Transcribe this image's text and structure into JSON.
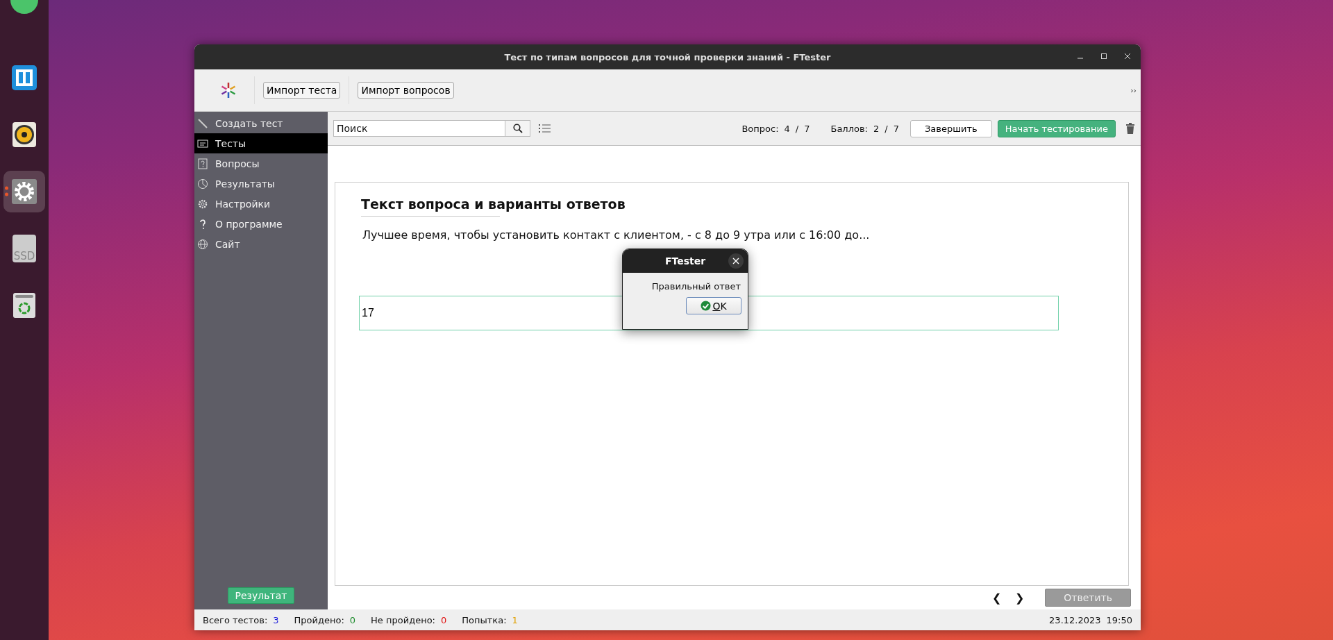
{
  "dock": [
    {
      "kind": "green",
      "running": false
    },
    {
      "kind": "split",
      "running": false
    },
    {
      "kind": "speaker",
      "running": false
    },
    {
      "kind": "gear",
      "running": true
    },
    {
      "kind": "ssd",
      "label": "SSD",
      "running": false
    },
    {
      "kind": "trash",
      "running": false
    }
  ],
  "window": {
    "title": "Тест по типам вопросов для точной проверки знаний - FTester"
  },
  "toolbar": {
    "buttons": [
      "Импорт теста",
      "Импорт вопросов"
    ],
    "overflow": "››"
  },
  "sidebar": {
    "items": [
      {
        "label": "Создать тест",
        "selected": false
      },
      {
        "label": "Тесты",
        "selected": true
      },
      {
        "label": "Вопросы",
        "selected": false
      },
      {
        "label": "Результаты",
        "selected": false
      },
      {
        "label": "Настройки",
        "selected": false
      },
      {
        "label": "О программе",
        "selected": false
      },
      {
        "label": "Сайт",
        "selected": false
      }
    ],
    "result_button": "Результат"
  },
  "top_bar": {
    "search": {
      "placeholder": "Поиск"
    },
    "question_label": "Вопрос:",
    "question_current": "4",
    "question_sep": "/",
    "question_total": "7",
    "score_label": "Баллов:",
    "score_current": "2",
    "score_sep": "/",
    "score_total": "7",
    "finish_button": "Завершить",
    "start_button": "Начать тестирование"
  },
  "question": {
    "heading": "Текст вопроса и варианты ответов",
    "text": "Лучшее время, чтобы установить контакт с клиентом, - с 8 до 9 утра или с 16:00 до...",
    "answer": "17"
  },
  "nav": {
    "prev": "❮",
    "next": "❯",
    "answer_button": "Ответить",
    "answer_disabled": true
  },
  "status_bar": {
    "items": [
      {
        "label": "Всего тестов:",
        "value": "3",
        "color": "#1a1adc"
      },
      {
        "label": "Пройдено:",
        "value": "0",
        "color": "#1a8a2a"
      },
      {
        "label": "Не пройдено:",
        "value": "0",
        "color": "#e01010"
      },
      {
        "label": "Попытка:",
        "value": "1",
        "color": "#e0a000"
      }
    ],
    "date": "23.12.2023",
    "time": "19:50"
  },
  "dialog": {
    "title": "FTester",
    "message": "Правильный ответ",
    "ok": "OK"
  }
}
